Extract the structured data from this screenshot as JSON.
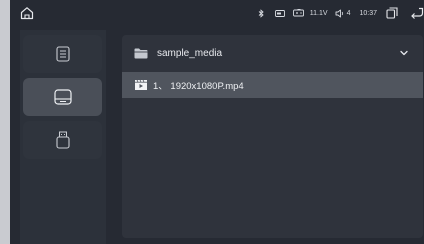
{
  "status": {
    "voltage": "11.1V",
    "volume": "4",
    "time": "10:37"
  },
  "icons": {
    "home": "home-icon",
    "bluetooth": "bluetooth-icon",
    "sd_card": "sd-card-icon",
    "battery": "battery-icon",
    "volume": "volume-icon",
    "recent_apps": "recent-apps-icon",
    "back": "back-icon"
  },
  "sidebar": {
    "items": [
      {
        "icon": "document-list-icon",
        "active": false
      },
      {
        "icon": "drive-icon",
        "active": true
      },
      {
        "icon": "usb-icon",
        "active": false
      }
    ]
  },
  "browser": {
    "folder_name": "sample_media",
    "files": [
      {
        "index": "1、",
        "name": "1920x1080P.mp4",
        "label": "1、 1920x1080P.mp4"
      }
    ]
  }
}
